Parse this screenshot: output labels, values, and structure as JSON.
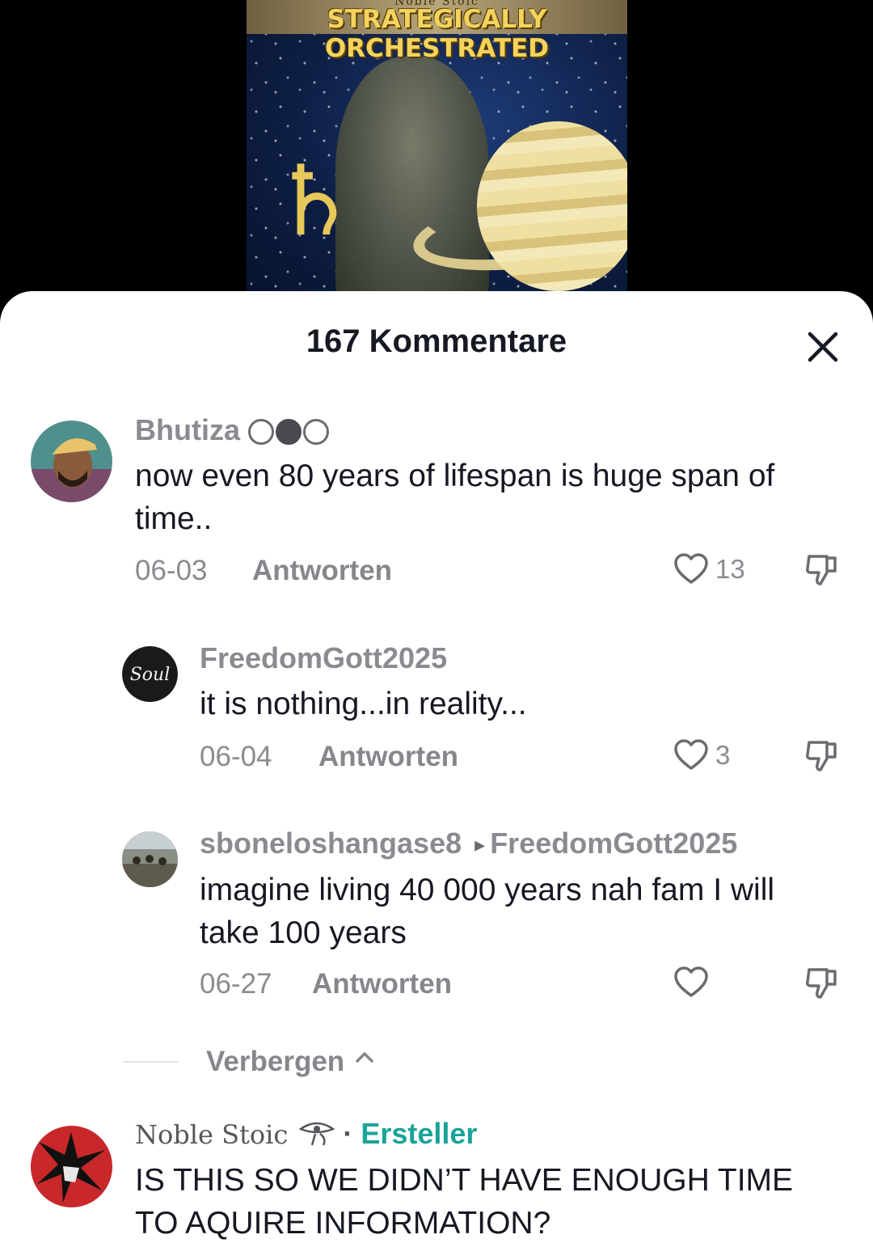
{
  "video": {
    "brand_text": "Noble Stoic",
    "title_line1": "STRATEGICALLY",
    "title_line2": "ORCHESTRATED",
    "symbol": "♄"
  },
  "sheet": {
    "title": "167 Kommentare",
    "close_icon": "close-icon"
  },
  "comments": [
    {
      "username": "Bhutiza",
      "text": "now even 80 years of lifespan is huge span of time..",
      "date": "06-03",
      "reply_label": "Antworten",
      "likes": "13"
    },
    {
      "username": "FreedomGott2025",
      "avatar_text": "Soul",
      "text": "it is nothing...in reality...",
      "date": "06-04",
      "reply_label": "Antworten",
      "likes": "3"
    },
    {
      "username": "sboneloshangase8",
      "reply_to_arrow": "▸",
      "reply_to": "FreedomGott2025",
      "text": "imagine living 40 000 years nah fam I will take 100 years",
      "date": "06-27",
      "reply_label": "Antworten",
      "likes": ""
    },
    {
      "username": "Noble Stoic",
      "separator": "·",
      "badge": "Ersteller",
      "text": "IS THIS SO WE DIDN’T HAVE ENOUGH TIME TO AQUIRE INFORMATION?"
    }
  ],
  "hide_replies": {
    "label": "Verbergen"
  },
  "colors": {
    "sheet_bg": "#ffffff",
    "text_primary": "#161823",
    "text_secondary": "#8a8b91",
    "creator_badge": "#1aa39a"
  }
}
